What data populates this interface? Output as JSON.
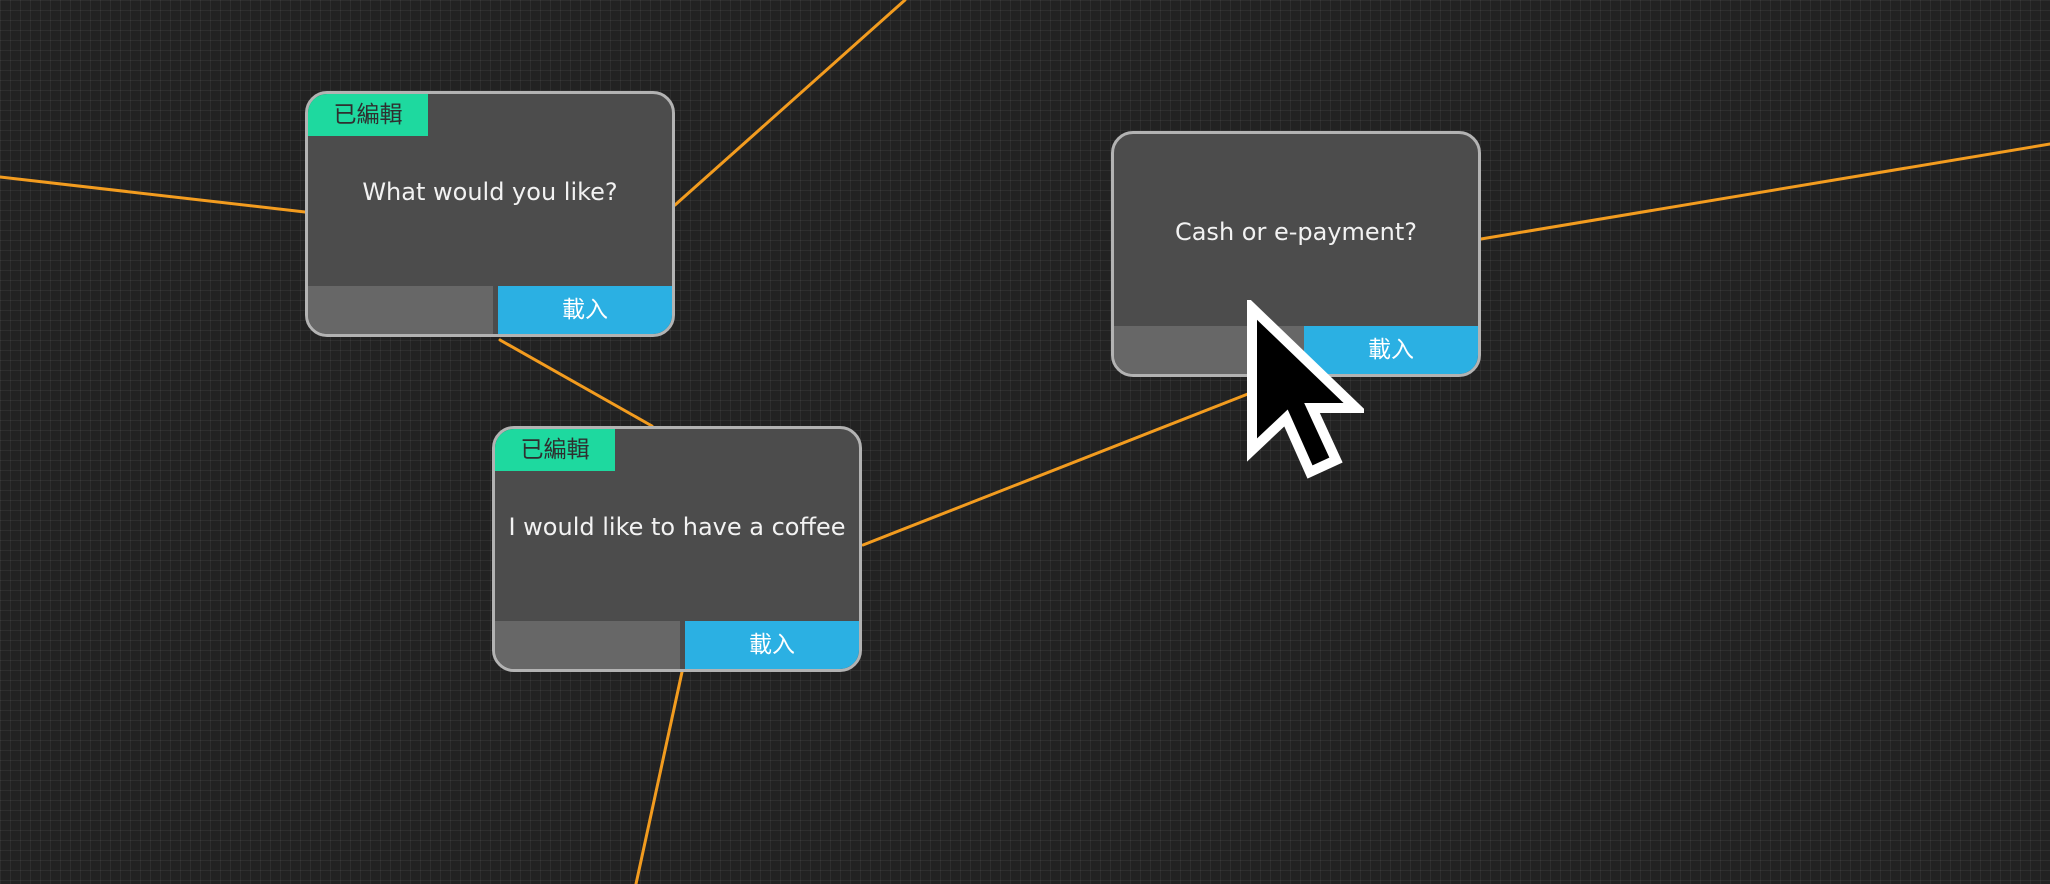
{
  "canvas": {
    "background": "#222222",
    "grid": true,
    "connector_color": "#f39c1f"
  },
  "nodes": [
    {
      "id": "what",
      "badge": "已編輯",
      "text": "What would you like?",
      "load_label": "載入"
    },
    {
      "id": "coffee",
      "badge": "已編輯",
      "text": "I would like to have a coffee",
      "load_label": "載入"
    },
    {
      "id": "cash",
      "badge": "",
      "text": "Cash or e-payment?",
      "load_label": "載入"
    }
  ],
  "colors": {
    "badge": "#1ed99f",
    "load_button": "#2bb0e3",
    "node_body": "#4c4c4c",
    "node_border": "#b3b3b3"
  },
  "cursor": {
    "icon": "arrow-cursor-icon"
  }
}
